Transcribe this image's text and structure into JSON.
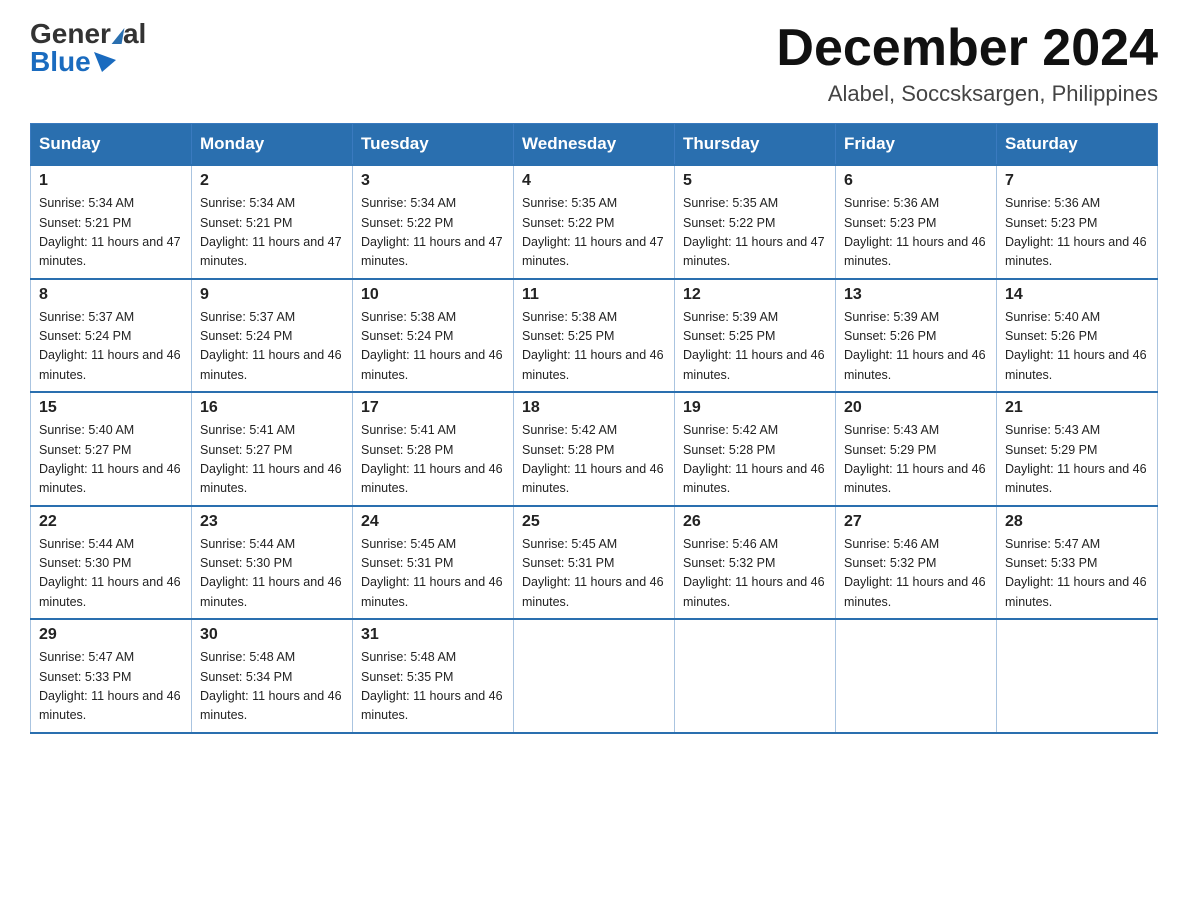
{
  "logo": {
    "general": "General",
    "blue": "Blue"
  },
  "title": "December 2024",
  "subtitle": "Alabel, Soccsksargen, Philippines",
  "days_header": [
    "Sunday",
    "Monday",
    "Tuesday",
    "Wednesday",
    "Thursday",
    "Friday",
    "Saturday"
  ],
  "weeks": [
    [
      {
        "day": "1",
        "sunrise": "5:34 AM",
        "sunset": "5:21 PM",
        "daylight": "11 hours and 47 minutes."
      },
      {
        "day": "2",
        "sunrise": "5:34 AM",
        "sunset": "5:21 PM",
        "daylight": "11 hours and 47 minutes."
      },
      {
        "day": "3",
        "sunrise": "5:34 AM",
        "sunset": "5:22 PM",
        "daylight": "11 hours and 47 minutes."
      },
      {
        "day": "4",
        "sunrise": "5:35 AM",
        "sunset": "5:22 PM",
        "daylight": "11 hours and 47 minutes."
      },
      {
        "day": "5",
        "sunrise": "5:35 AM",
        "sunset": "5:22 PM",
        "daylight": "11 hours and 47 minutes."
      },
      {
        "day": "6",
        "sunrise": "5:36 AM",
        "sunset": "5:23 PM",
        "daylight": "11 hours and 46 minutes."
      },
      {
        "day": "7",
        "sunrise": "5:36 AM",
        "sunset": "5:23 PM",
        "daylight": "11 hours and 46 minutes."
      }
    ],
    [
      {
        "day": "8",
        "sunrise": "5:37 AM",
        "sunset": "5:24 PM",
        "daylight": "11 hours and 46 minutes."
      },
      {
        "day": "9",
        "sunrise": "5:37 AM",
        "sunset": "5:24 PM",
        "daylight": "11 hours and 46 minutes."
      },
      {
        "day": "10",
        "sunrise": "5:38 AM",
        "sunset": "5:24 PM",
        "daylight": "11 hours and 46 minutes."
      },
      {
        "day": "11",
        "sunrise": "5:38 AM",
        "sunset": "5:25 PM",
        "daylight": "11 hours and 46 minutes."
      },
      {
        "day": "12",
        "sunrise": "5:39 AM",
        "sunset": "5:25 PM",
        "daylight": "11 hours and 46 minutes."
      },
      {
        "day": "13",
        "sunrise": "5:39 AM",
        "sunset": "5:26 PM",
        "daylight": "11 hours and 46 minutes."
      },
      {
        "day": "14",
        "sunrise": "5:40 AM",
        "sunset": "5:26 PM",
        "daylight": "11 hours and 46 minutes."
      }
    ],
    [
      {
        "day": "15",
        "sunrise": "5:40 AM",
        "sunset": "5:27 PM",
        "daylight": "11 hours and 46 minutes."
      },
      {
        "day": "16",
        "sunrise": "5:41 AM",
        "sunset": "5:27 PM",
        "daylight": "11 hours and 46 minutes."
      },
      {
        "day": "17",
        "sunrise": "5:41 AM",
        "sunset": "5:28 PM",
        "daylight": "11 hours and 46 minutes."
      },
      {
        "day": "18",
        "sunrise": "5:42 AM",
        "sunset": "5:28 PM",
        "daylight": "11 hours and 46 minutes."
      },
      {
        "day": "19",
        "sunrise": "5:42 AM",
        "sunset": "5:28 PM",
        "daylight": "11 hours and 46 minutes."
      },
      {
        "day": "20",
        "sunrise": "5:43 AM",
        "sunset": "5:29 PM",
        "daylight": "11 hours and 46 minutes."
      },
      {
        "day": "21",
        "sunrise": "5:43 AM",
        "sunset": "5:29 PM",
        "daylight": "11 hours and 46 minutes."
      }
    ],
    [
      {
        "day": "22",
        "sunrise": "5:44 AM",
        "sunset": "5:30 PM",
        "daylight": "11 hours and 46 minutes."
      },
      {
        "day": "23",
        "sunrise": "5:44 AM",
        "sunset": "5:30 PM",
        "daylight": "11 hours and 46 minutes."
      },
      {
        "day": "24",
        "sunrise": "5:45 AM",
        "sunset": "5:31 PM",
        "daylight": "11 hours and 46 minutes."
      },
      {
        "day": "25",
        "sunrise": "5:45 AM",
        "sunset": "5:31 PM",
        "daylight": "11 hours and 46 minutes."
      },
      {
        "day": "26",
        "sunrise": "5:46 AM",
        "sunset": "5:32 PM",
        "daylight": "11 hours and 46 minutes."
      },
      {
        "day": "27",
        "sunrise": "5:46 AM",
        "sunset": "5:32 PM",
        "daylight": "11 hours and 46 minutes."
      },
      {
        "day": "28",
        "sunrise": "5:47 AM",
        "sunset": "5:33 PM",
        "daylight": "11 hours and 46 minutes."
      }
    ],
    [
      {
        "day": "29",
        "sunrise": "5:47 AM",
        "sunset": "5:33 PM",
        "daylight": "11 hours and 46 minutes."
      },
      {
        "day": "30",
        "sunrise": "5:48 AM",
        "sunset": "5:34 PM",
        "daylight": "11 hours and 46 minutes."
      },
      {
        "day": "31",
        "sunrise": "5:48 AM",
        "sunset": "5:35 PM",
        "daylight": "11 hours and 46 minutes."
      },
      null,
      null,
      null,
      null
    ]
  ]
}
